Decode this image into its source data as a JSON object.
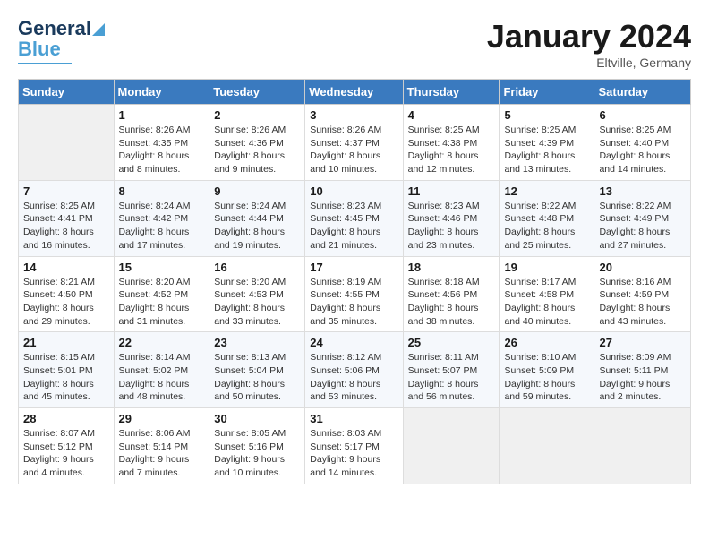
{
  "header": {
    "logo_line1": "General",
    "logo_line2": "Blue",
    "month": "January 2024",
    "location": "Eltville, Germany"
  },
  "weekdays": [
    "Sunday",
    "Monday",
    "Tuesday",
    "Wednesday",
    "Thursday",
    "Friday",
    "Saturday"
  ],
  "weeks": [
    [
      {
        "day": "",
        "sunrise": "",
        "sunset": "",
        "daylight": ""
      },
      {
        "day": "1",
        "sunrise": "Sunrise: 8:26 AM",
        "sunset": "Sunset: 4:35 PM",
        "daylight": "Daylight: 8 hours and 8 minutes."
      },
      {
        "day": "2",
        "sunrise": "Sunrise: 8:26 AM",
        "sunset": "Sunset: 4:36 PM",
        "daylight": "Daylight: 8 hours and 9 minutes."
      },
      {
        "day": "3",
        "sunrise": "Sunrise: 8:26 AM",
        "sunset": "Sunset: 4:37 PM",
        "daylight": "Daylight: 8 hours and 10 minutes."
      },
      {
        "day": "4",
        "sunrise": "Sunrise: 8:25 AM",
        "sunset": "Sunset: 4:38 PM",
        "daylight": "Daylight: 8 hours and 12 minutes."
      },
      {
        "day": "5",
        "sunrise": "Sunrise: 8:25 AM",
        "sunset": "Sunset: 4:39 PM",
        "daylight": "Daylight: 8 hours and 13 minutes."
      },
      {
        "day": "6",
        "sunrise": "Sunrise: 8:25 AM",
        "sunset": "Sunset: 4:40 PM",
        "daylight": "Daylight: 8 hours and 14 minutes."
      }
    ],
    [
      {
        "day": "7",
        "sunrise": "Sunrise: 8:25 AM",
        "sunset": "Sunset: 4:41 PM",
        "daylight": "Daylight: 8 hours and 16 minutes."
      },
      {
        "day": "8",
        "sunrise": "Sunrise: 8:24 AM",
        "sunset": "Sunset: 4:42 PM",
        "daylight": "Daylight: 8 hours and 17 minutes."
      },
      {
        "day": "9",
        "sunrise": "Sunrise: 8:24 AM",
        "sunset": "Sunset: 4:44 PM",
        "daylight": "Daylight: 8 hours and 19 minutes."
      },
      {
        "day": "10",
        "sunrise": "Sunrise: 8:23 AM",
        "sunset": "Sunset: 4:45 PM",
        "daylight": "Daylight: 8 hours and 21 minutes."
      },
      {
        "day": "11",
        "sunrise": "Sunrise: 8:23 AM",
        "sunset": "Sunset: 4:46 PM",
        "daylight": "Daylight: 8 hours and 23 minutes."
      },
      {
        "day": "12",
        "sunrise": "Sunrise: 8:22 AM",
        "sunset": "Sunset: 4:48 PM",
        "daylight": "Daylight: 8 hours and 25 minutes."
      },
      {
        "day": "13",
        "sunrise": "Sunrise: 8:22 AM",
        "sunset": "Sunset: 4:49 PM",
        "daylight": "Daylight: 8 hours and 27 minutes."
      }
    ],
    [
      {
        "day": "14",
        "sunrise": "Sunrise: 8:21 AM",
        "sunset": "Sunset: 4:50 PM",
        "daylight": "Daylight: 8 hours and 29 minutes."
      },
      {
        "day": "15",
        "sunrise": "Sunrise: 8:20 AM",
        "sunset": "Sunset: 4:52 PM",
        "daylight": "Daylight: 8 hours and 31 minutes."
      },
      {
        "day": "16",
        "sunrise": "Sunrise: 8:20 AM",
        "sunset": "Sunset: 4:53 PM",
        "daylight": "Daylight: 8 hours and 33 minutes."
      },
      {
        "day": "17",
        "sunrise": "Sunrise: 8:19 AM",
        "sunset": "Sunset: 4:55 PM",
        "daylight": "Daylight: 8 hours and 35 minutes."
      },
      {
        "day": "18",
        "sunrise": "Sunrise: 8:18 AM",
        "sunset": "Sunset: 4:56 PM",
        "daylight": "Daylight: 8 hours and 38 minutes."
      },
      {
        "day": "19",
        "sunrise": "Sunrise: 8:17 AM",
        "sunset": "Sunset: 4:58 PM",
        "daylight": "Daylight: 8 hours and 40 minutes."
      },
      {
        "day": "20",
        "sunrise": "Sunrise: 8:16 AM",
        "sunset": "Sunset: 4:59 PM",
        "daylight": "Daylight: 8 hours and 43 minutes."
      }
    ],
    [
      {
        "day": "21",
        "sunrise": "Sunrise: 8:15 AM",
        "sunset": "Sunset: 5:01 PM",
        "daylight": "Daylight: 8 hours and 45 minutes."
      },
      {
        "day": "22",
        "sunrise": "Sunrise: 8:14 AM",
        "sunset": "Sunset: 5:02 PM",
        "daylight": "Daylight: 8 hours and 48 minutes."
      },
      {
        "day": "23",
        "sunrise": "Sunrise: 8:13 AM",
        "sunset": "Sunset: 5:04 PM",
        "daylight": "Daylight: 8 hours and 50 minutes."
      },
      {
        "day": "24",
        "sunrise": "Sunrise: 8:12 AM",
        "sunset": "Sunset: 5:06 PM",
        "daylight": "Daylight: 8 hours and 53 minutes."
      },
      {
        "day": "25",
        "sunrise": "Sunrise: 8:11 AM",
        "sunset": "Sunset: 5:07 PM",
        "daylight": "Daylight: 8 hours and 56 minutes."
      },
      {
        "day": "26",
        "sunrise": "Sunrise: 8:10 AM",
        "sunset": "Sunset: 5:09 PM",
        "daylight": "Daylight: 8 hours and 59 minutes."
      },
      {
        "day": "27",
        "sunrise": "Sunrise: 8:09 AM",
        "sunset": "Sunset: 5:11 PM",
        "daylight": "Daylight: 9 hours and 2 minutes."
      }
    ],
    [
      {
        "day": "28",
        "sunrise": "Sunrise: 8:07 AM",
        "sunset": "Sunset: 5:12 PM",
        "daylight": "Daylight: 9 hours and 4 minutes."
      },
      {
        "day": "29",
        "sunrise": "Sunrise: 8:06 AM",
        "sunset": "Sunset: 5:14 PM",
        "daylight": "Daylight: 9 hours and 7 minutes."
      },
      {
        "day": "30",
        "sunrise": "Sunrise: 8:05 AM",
        "sunset": "Sunset: 5:16 PM",
        "daylight": "Daylight: 9 hours and 10 minutes."
      },
      {
        "day": "31",
        "sunrise": "Sunrise: 8:03 AM",
        "sunset": "Sunset: 5:17 PM",
        "daylight": "Daylight: 9 hours and 14 minutes."
      },
      {
        "day": "",
        "sunrise": "",
        "sunset": "",
        "daylight": ""
      },
      {
        "day": "",
        "sunrise": "",
        "sunset": "",
        "daylight": ""
      },
      {
        "day": "",
        "sunrise": "",
        "sunset": "",
        "daylight": ""
      }
    ]
  ]
}
